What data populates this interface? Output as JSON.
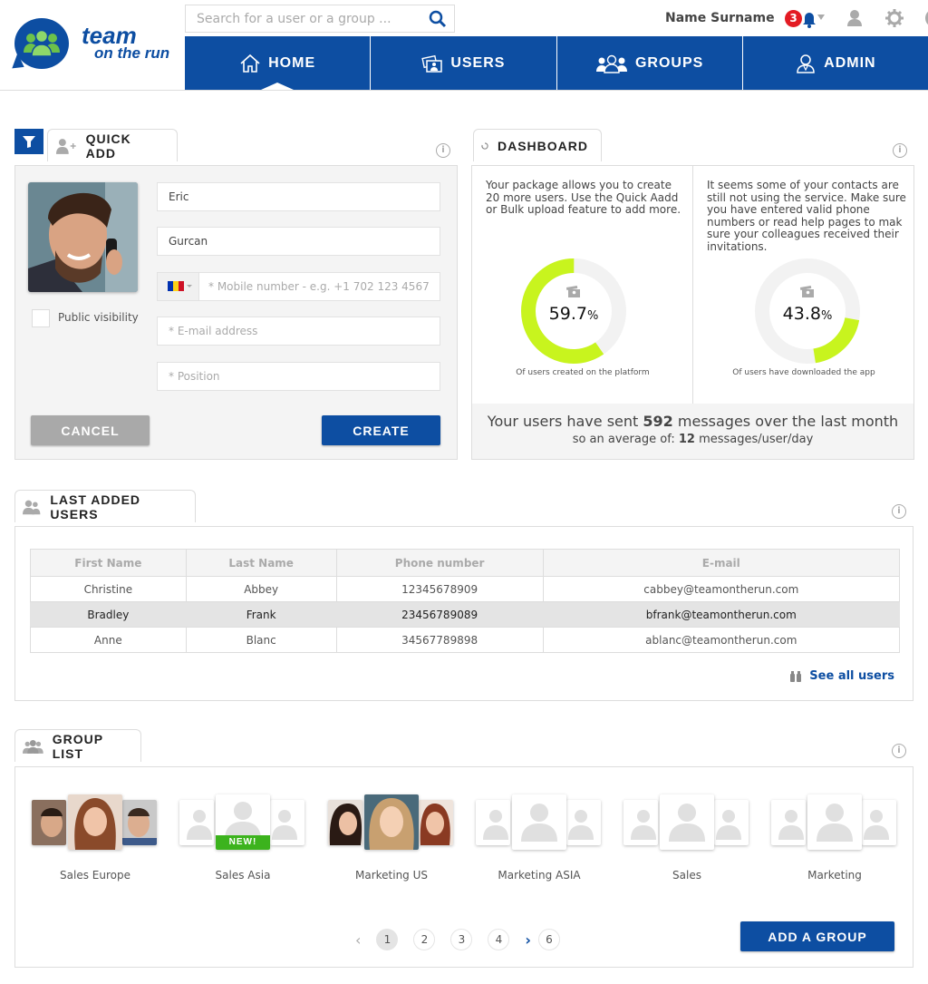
{
  "brand": {
    "line1": "team",
    "line2": "on the run",
    "color": "#0d4ea2",
    "accent": "#6cc24a"
  },
  "search": {
    "placeholder": "Search for a user or a group ..."
  },
  "user": {
    "name": "Name Surname",
    "notifications": "3"
  },
  "toolbar_icons": [
    "bell-icon",
    "profile-icon",
    "settings-icon",
    "help-icon",
    "power-icon"
  ],
  "nav": {
    "tabs": [
      {
        "label": "HOME",
        "icon": "home-icon",
        "active": true
      },
      {
        "label": "USERS",
        "icon": "users-card-icon"
      },
      {
        "label": "GROUPS",
        "icon": "groups-icon"
      },
      {
        "label": "ADMIN",
        "icon": "admin-icon"
      }
    ]
  },
  "quick_add": {
    "title": "QUICK ADD",
    "first_name": "Eric",
    "last_name": "Gurcan",
    "mobile_placeholder": "* Mobile number - e.g. +1 702 123 4567",
    "email_placeholder": "* E-mail address",
    "position_placeholder": "* Position",
    "country_flag": "Romania",
    "public_visibility_label": "Public visibility",
    "public_visibility_checked": false,
    "cancel_label": "CANCEL",
    "create_label": "CREATE"
  },
  "dashboard": {
    "title": "DASHBOARD",
    "left_text": "Your package allows you to create 20 more users. Use the Quick Aadd or Bulk upload feature to add more.",
    "right_text": "It seems some of your contacts are still not using the service. Make sure you have entered valid phone numbers or read help pages to mak sure your colleagues received their invitations.",
    "stat1": {
      "value": "59.7",
      "unit": "%",
      "fraction": 0.597,
      "caption": "Of users created on the platform"
    },
    "stat2": {
      "value": "43.8",
      "unit": "%",
      "fraction": 0.438,
      "caption": "Of users have downloaded the app"
    },
    "messages_pre": "Your users have sent ",
    "messages_count": "592",
    "messages_post": " messages over the last month",
    "avg_pre": "so an average of: ",
    "avg_value": "12",
    "avg_post": " messages/user/day",
    "ring_color": "#c8f41e",
    "ring_bg": "#f2f2f2"
  },
  "last_users": {
    "title": "LAST ADDED USERS",
    "columns": [
      "First Name",
      "Last Name",
      "Phone number",
      "E-mail"
    ],
    "rows": [
      [
        "Christine",
        "Abbey",
        "12345678909",
        "cabbey@teamontherun.com"
      ],
      [
        "Bradley",
        "Frank",
        "23456789089",
        "bfrank@teamontherun.com"
      ],
      [
        "Anne",
        "Blanc",
        "34567789898",
        "ablanc@teamontherun.com"
      ]
    ],
    "selected_row": 1,
    "see_all_label": "See all users"
  },
  "groups": {
    "title": "GROUP LIST",
    "items": [
      {
        "name": "Sales Europe",
        "photos": true,
        "new": false
      },
      {
        "name": "Sales Asia",
        "photos": false,
        "new": true,
        "new_label": "NEW!"
      },
      {
        "name": "Marketing US",
        "photos": true,
        "new": false
      },
      {
        "name": "Marketing ASIA",
        "photos": false,
        "new": false
      },
      {
        "name": "Sales",
        "photos": false,
        "new": false
      },
      {
        "name": "Marketing",
        "photos": false,
        "new": false
      }
    ],
    "pages": [
      "1",
      "2",
      "3",
      "4",
      "6"
    ],
    "current_page": "1",
    "add_label": "ADD A GROUP"
  }
}
